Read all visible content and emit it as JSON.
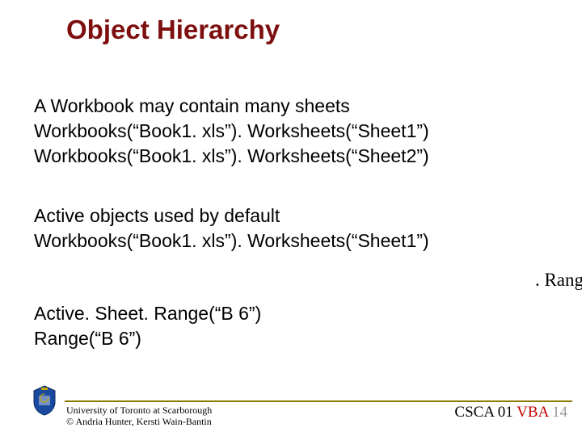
{
  "title": "Object Hierarchy",
  "section1": {
    "line1": "A Workbook may contain many sheets",
    "line2": "Workbooks(“Book1. xls”). Worksheets(“Sheet1”)",
    "line3": "Workbooks(“Book1. xls”). Worksheets(“Sheet2”)"
  },
  "section2": {
    "line1": "Active objects used by default",
    "line2": "Workbooks(“Book1. xls”). Worksheets(“Sheet1”)"
  },
  "overflow_right": ". Rang",
  "section3": {
    "line1": "Active. Sheet. Range(“B 6”)",
    "line2": "Range(“B 6”)"
  },
  "footer": {
    "uni_line1": "University of Toronto at Scarborough",
    "uni_line2": "© Andria Hunter, Kersti Wain-Bantin",
    "course_code": "CSCA 01",
    "course_topic": "VBA",
    "slide_num": "14"
  }
}
